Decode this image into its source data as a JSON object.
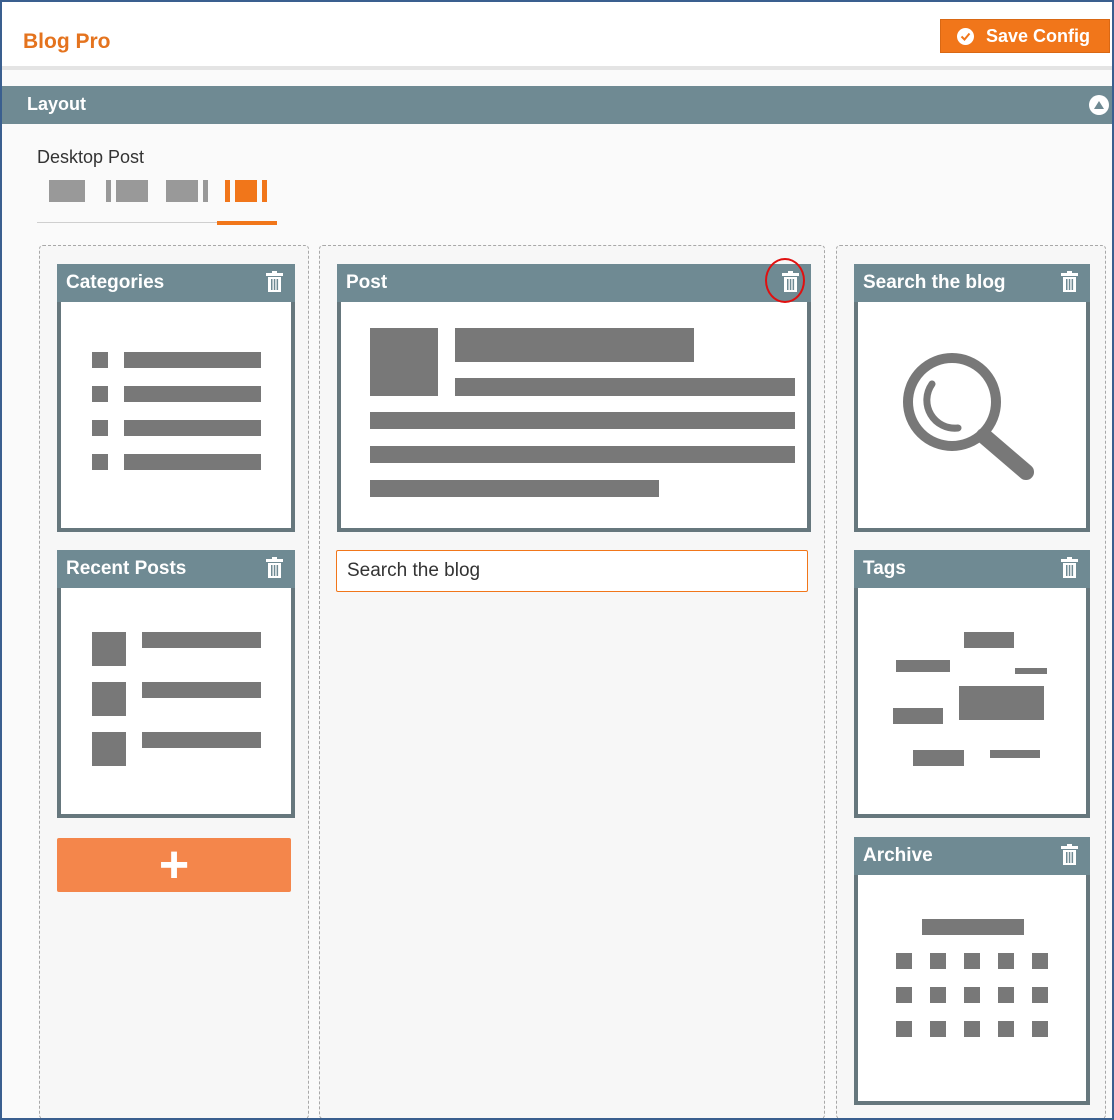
{
  "header": {
    "title": "Blog Pro",
    "save_label": "Save Config"
  },
  "section": {
    "title": "Layout"
  },
  "layout": {
    "label": "Desktop Post",
    "selected_option_index": 3
  },
  "widgets": {
    "categories": {
      "title": "Categories"
    },
    "recent_posts": {
      "title": "Recent Posts"
    },
    "post": {
      "title": "Post"
    },
    "search": {
      "title": "Search the blog"
    },
    "tags": {
      "title": "Tags"
    },
    "archive": {
      "title": "Archive"
    }
  },
  "search_field": {
    "value": "Search the blog"
  },
  "add_widget": {
    "label": "+"
  },
  "colors": {
    "accent": "#f1761a",
    "header": "#6f8a93",
    "placeholder_block": "#787878",
    "frame_border": "#3a5f8f"
  }
}
